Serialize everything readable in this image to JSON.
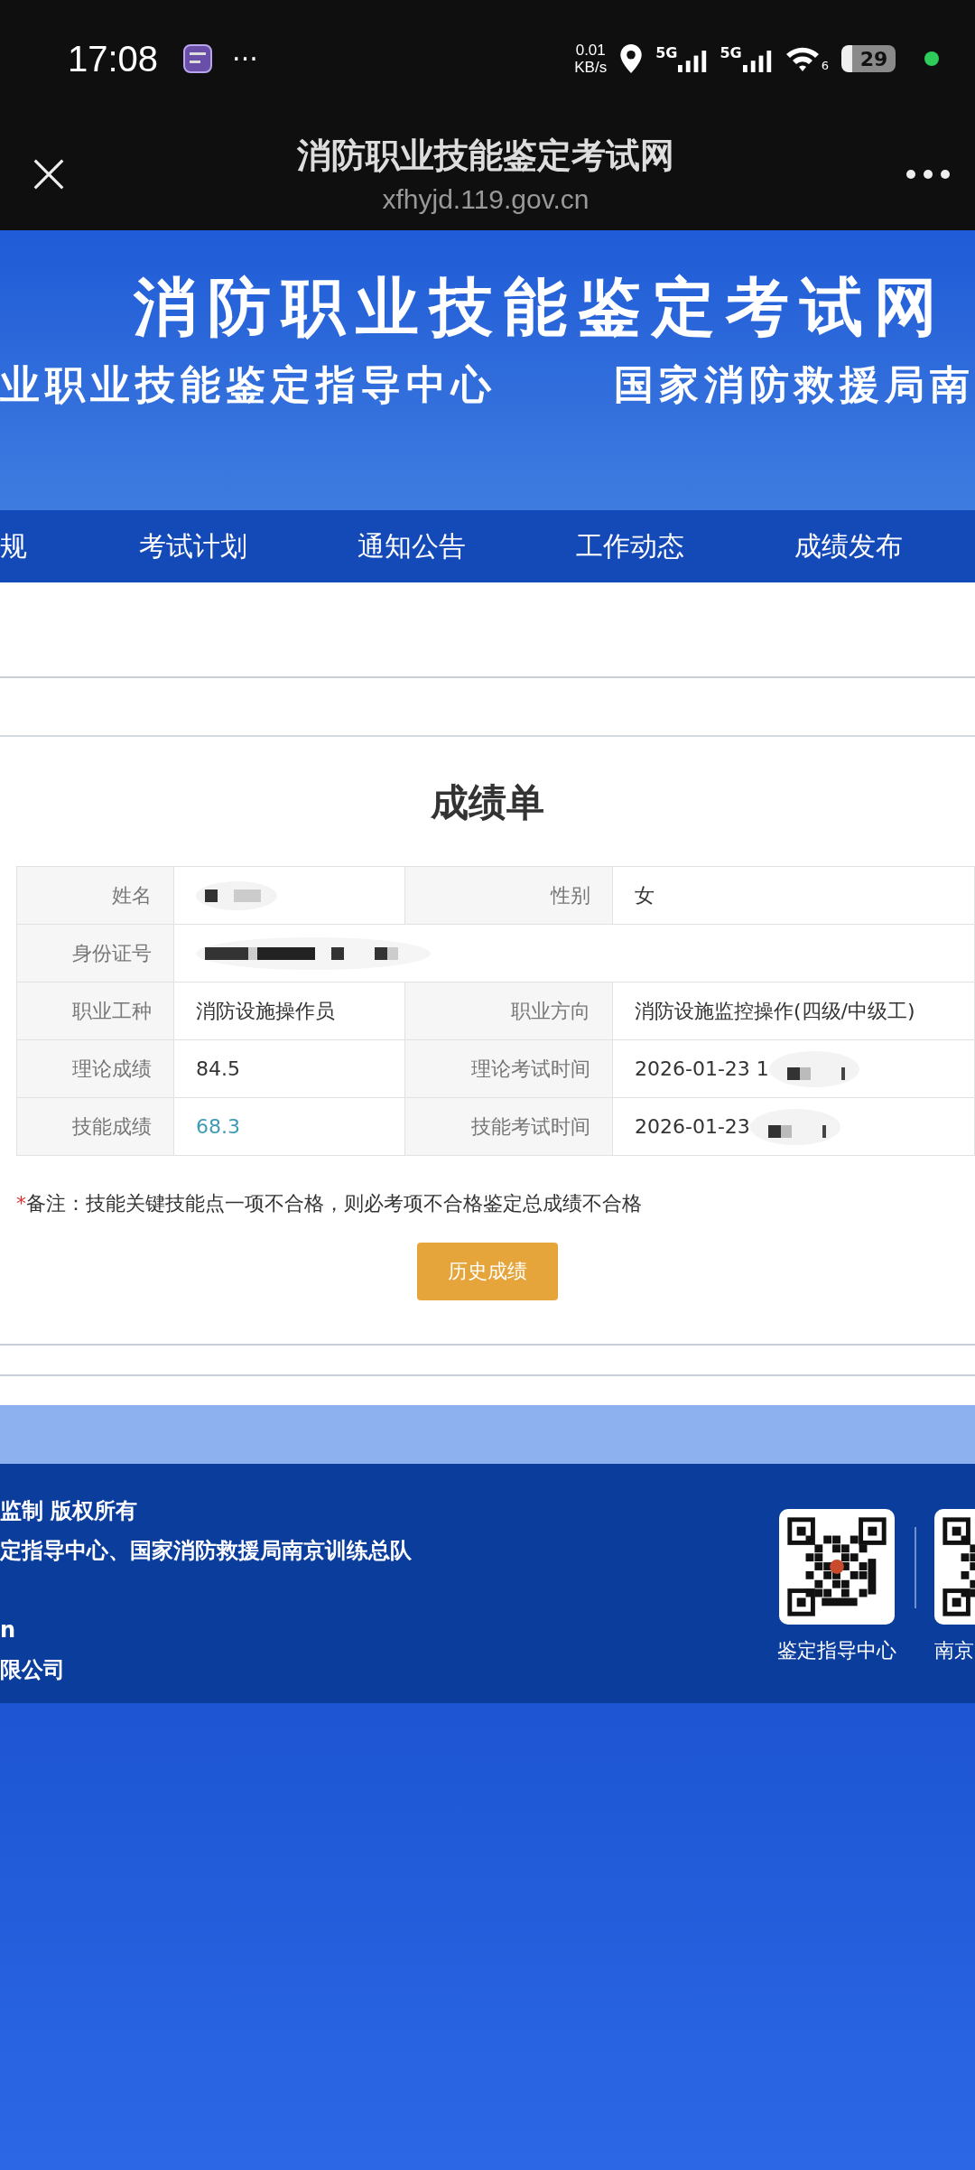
{
  "status_bar": {
    "time": "17:08",
    "more": "···",
    "net_speed": "0.01",
    "net_unit": "KB/s",
    "signal_1": "5G",
    "signal_2": "5G",
    "wifi_band": "6",
    "battery": "29"
  },
  "browser": {
    "title": "消防职业技能鉴定考试网",
    "url": "xfhyjd.119.gov.cn"
  },
  "banner": {
    "title": "消防职业技能鉴定考试网",
    "subtitle_left": "业职业技能鉴定指导中心",
    "subtitle_right": "国家消防救援局南"
  },
  "nav": [
    {
      "label": "规"
    },
    {
      "label": "考试计划"
    },
    {
      "label": "通知公告"
    },
    {
      "label": "工作动态"
    },
    {
      "label": "成绩发布"
    }
  ],
  "score_card": {
    "title": "成绩单",
    "rows": [
      {
        "fields": [
          {
            "label": "姓名",
            "kind": "redacted"
          },
          {
            "label": "性别",
            "kind": "text",
            "value": "女",
            "emphasis": false
          }
        ]
      },
      {
        "fields": [
          {
            "label": "身份证号",
            "kind": "redacted"
          }
        ]
      },
      {
        "fields": [
          {
            "label": "职业工种",
            "kind": "text",
            "value": "消防设施操作员",
            "emphasis": false
          },
          {
            "label": "职业方向",
            "kind": "text",
            "value": "消防设施监控操作(四级/中级工)",
            "emphasis": false
          }
        ]
      },
      {
        "fields": [
          {
            "label": "理论成绩",
            "kind": "text",
            "value": "84.5",
            "emphasis": false
          },
          {
            "label": "理论考试时间",
            "kind": "partial",
            "value": "2026-01-23 1"
          }
        ]
      },
      {
        "fields": [
          {
            "label": "技能成绩",
            "kind": "text",
            "value": "68.3",
            "emphasis": true
          },
          {
            "label": "技能考试时间",
            "kind": "partial",
            "value": "2026-01-23"
          }
        ]
      }
    ],
    "note_mark": "*",
    "note": "备注：技能关键技能点一项不合格，则必考项不合格鉴定总成绩不合格",
    "button": "历史成绩"
  },
  "footer": {
    "lines": [
      "监制 版权所有",
      "定指导中心、国家消防救援局南京训练总队"
    ],
    "lines_lower": [
      "n",
      "限公司"
    ],
    "qr_codes": [
      {
        "caption": "鉴定指导中心"
      },
      {
        "caption": "南京"
      }
    ]
  }
}
